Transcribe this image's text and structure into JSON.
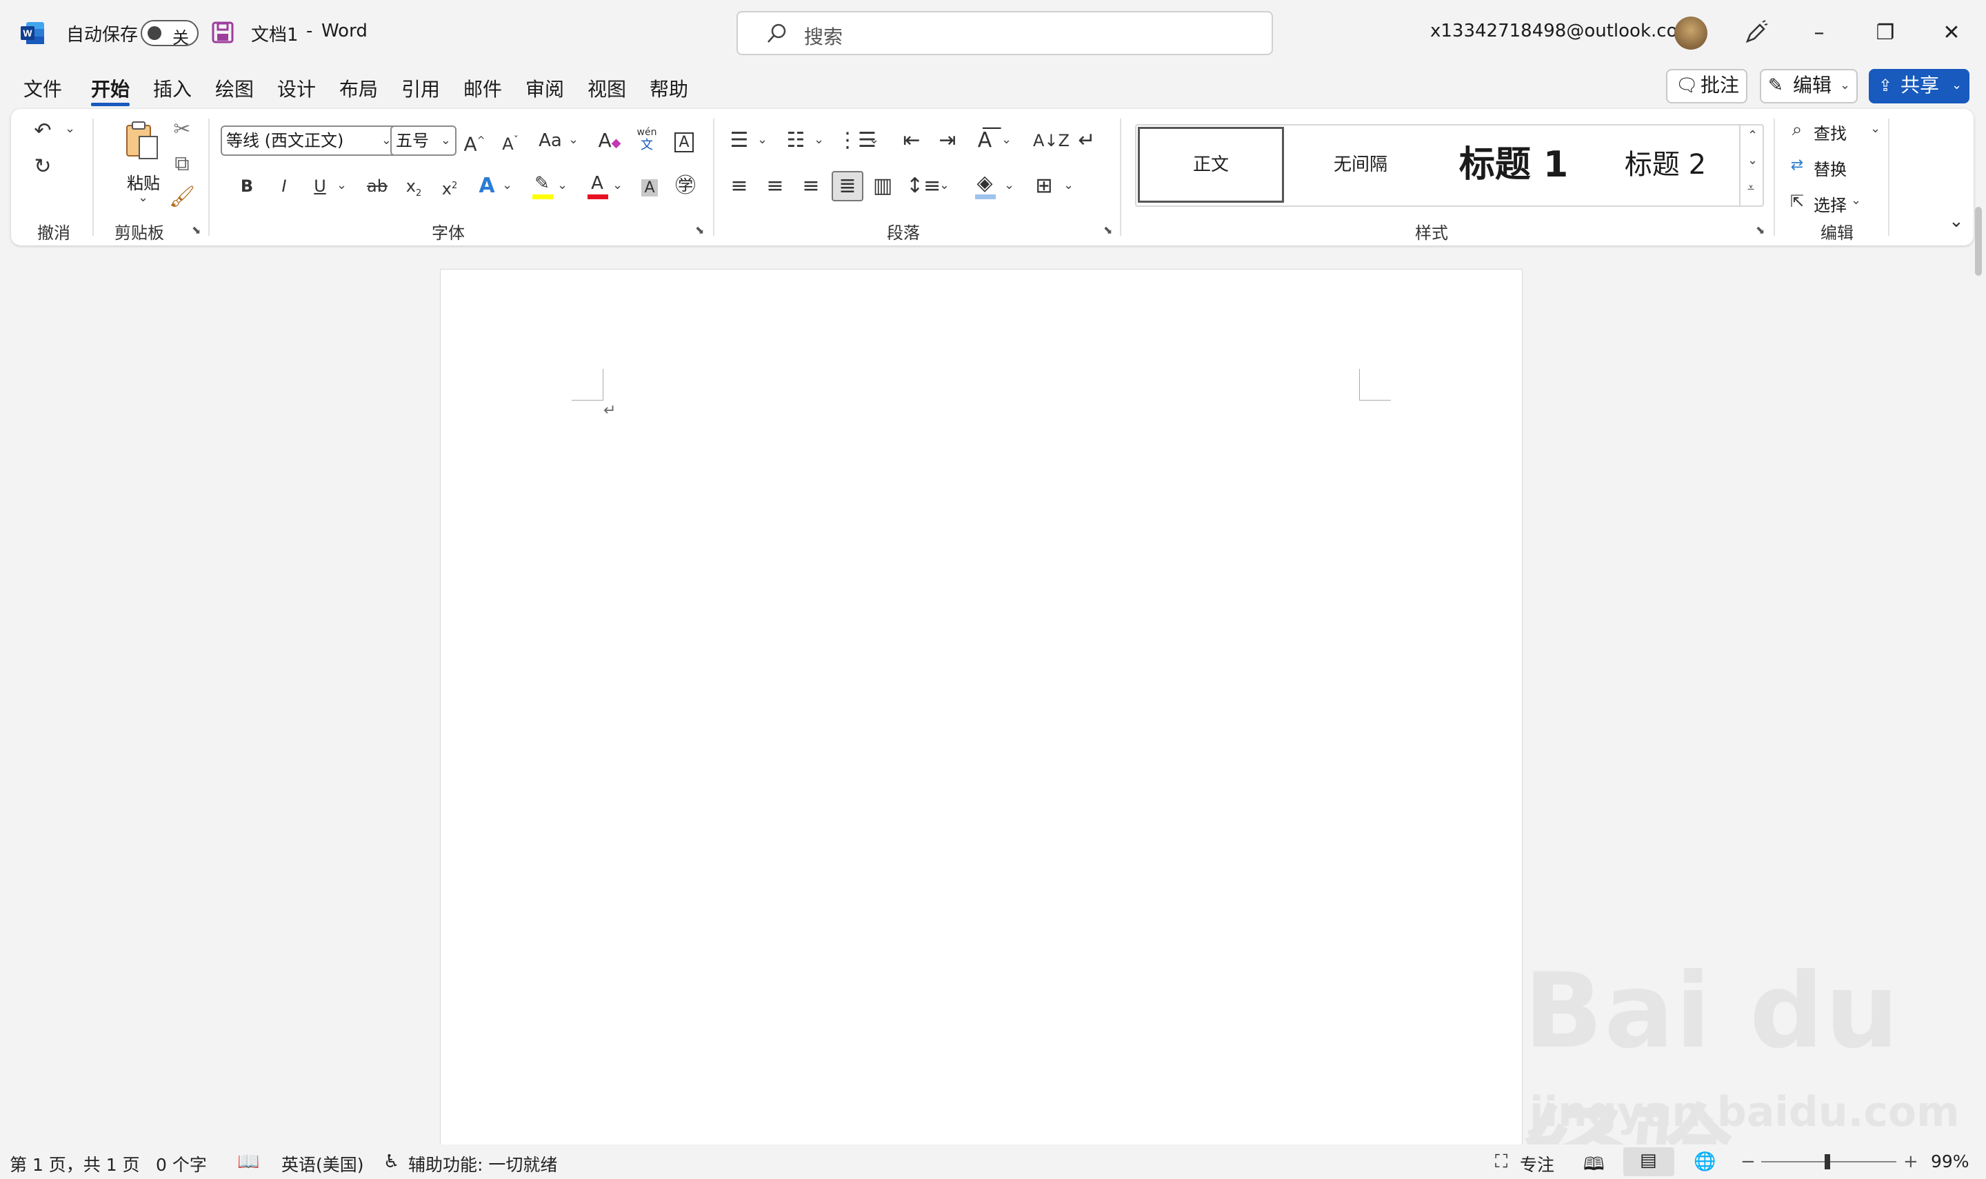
{
  "titlebar": {
    "autosave_label": "自动保存",
    "autosave_state": "关",
    "doc_title": "文档1",
    "separator": "-",
    "app_name": "Word",
    "search_placeholder": "搜索",
    "account": "x13342718498@outlook.com"
  },
  "menu": {
    "tabs": [
      "文件",
      "开始",
      "插入",
      "绘图",
      "设计",
      "布局",
      "引用",
      "邮件",
      "审阅",
      "视图",
      "帮助"
    ],
    "comment_label": "批注",
    "edit_label": "编辑",
    "share_label": "共享"
  },
  "ribbon": {
    "groups": {
      "undo": "撤消",
      "clipboard": "剪贴板",
      "font": "字体",
      "paragraph": "段落",
      "styles": "样式",
      "editing": "编辑"
    },
    "paste_label": "粘贴",
    "font_name": "等线 (西文正文)",
    "font_size": "五号",
    "phonetic_top": "wén",
    "phonetic_bottom": "文",
    "styles": [
      "正文",
      "无间隔",
      "标题 1",
      "标题 2"
    ],
    "find_label": "查找",
    "replace_label": "替换",
    "select_label": "选择"
  },
  "document": {
    "paragraph_mark": "↵"
  },
  "statusbar": {
    "page_info": "第 1 页，共 1 页",
    "word_count": "0 个字",
    "language": "英语(美国)",
    "accessibility": "辅助功能: 一切就绪",
    "focus_label": "专注",
    "zoom_level": "99%"
  },
  "watermark": {
    "logo_text": "Bai du 经验",
    "url": "jingyan.baidu.com"
  },
  "colors": {
    "accent": "#185abd",
    "highlight": "#ffff00",
    "font_color": "#e81123",
    "word_blue": "#185abd"
  }
}
